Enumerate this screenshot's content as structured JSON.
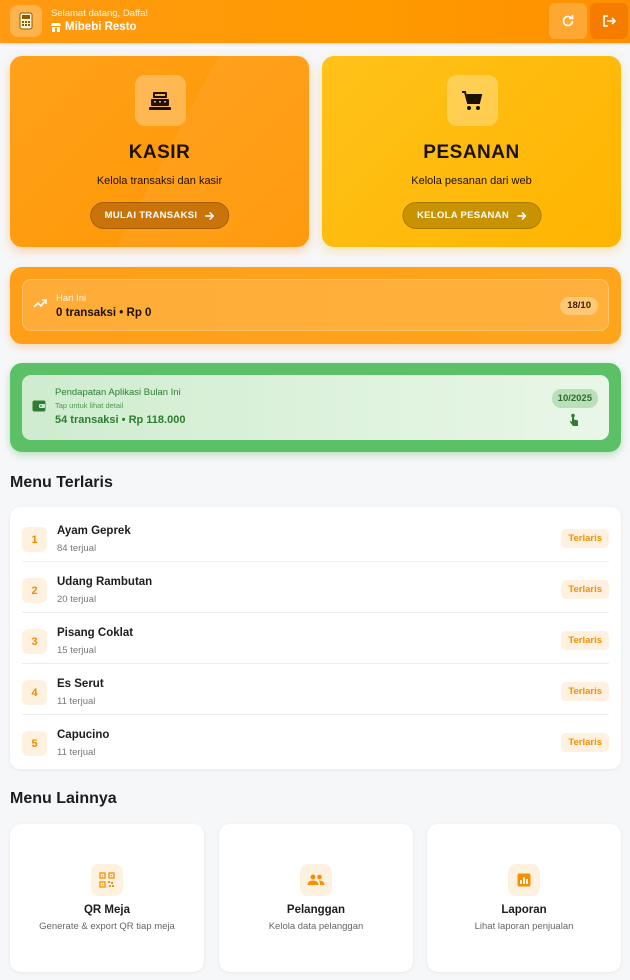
{
  "header": {
    "greeting": "Selamat datang, Daffa!",
    "restaurant_name": "Mibebi Resto",
    "icons": {
      "app": "pos-terminal-icon",
      "store": "store-icon",
      "refresh": "refresh-icon",
      "logout": "logout-icon"
    }
  },
  "cards": {
    "kasir": {
      "title": "KASIR",
      "subtitle": "Kelola transaksi dan kasir",
      "button": "MULAI TRANSAKSI",
      "icon": "cash-register-icon"
    },
    "pesanan": {
      "title": "PESANAN",
      "subtitle": "Kelola pesanan dari web",
      "button": "KELOLA PESANAN",
      "icon": "shopping-cart-icon"
    }
  },
  "today": {
    "label": "Hari Ini",
    "summary": "0 transaksi • Rp 0",
    "date": "18/10",
    "icon": "trending-up-icon"
  },
  "income": {
    "label": "Pendapatan Aplikasi Bulan Ini",
    "hint": "Tap untuk lihat detail",
    "summary": "54 transaksi • Rp 118.000",
    "period": "10/2025",
    "icon": "wallet-icon",
    "touch_icon": "touch-icon"
  },
  "best_sellers": {
    "title": "Menu Terlaris",
    "badge": "Terlaris",
    "items": [
      {
        "rank": "1",
        "name": "Ayam Geprek",
        "sold": "84 terjual"
      },
      {
        "rank": "2",
        "name": "Udang Rambutan",
        "sold": "20 terjual"
      },
      {
        "rank": "3",
        "name": "Pisang Coklat",
        "sold": "15 terjual"
      },
      {
        "rank": "4",
        "name": "Es Serut",
        "sold": "11 terjual"
      },
      {
        "rank": "5",
        "name": "Capucino",
        "sold": "11 terjual"
      }
    ]
  },
  "other_menu": {
    "title": "Menu Lainnya",
    "tiles": [
      {
        "title": "QR Meja",
        "subtitle": "Generate & export QR tiap meja",
        "icon": "qr-code-icon"
      },
      {
        "title": "Pelanggan",
        "subtitle": "Kelola data pelanggan",
        "icon": "people-icon"
      },
      {
        "title": "Laporan",
        "subtitle": "Lihat laporan penjualan",
        "icon": "report-chart-icon"
      }
    ]
  },
  "colors": {
    "primary": "#ff9a00",
    "amber": "#ffb400",
    "green": "#4caf50",
    "accent_text": "#f59100"
  }
}
